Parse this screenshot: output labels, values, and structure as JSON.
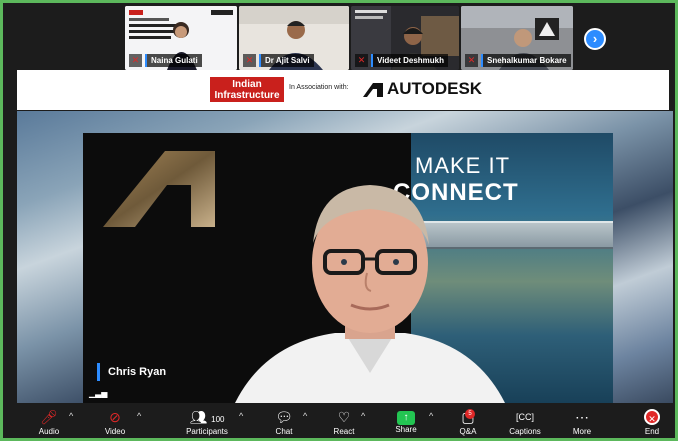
{
  "participants_strip": {
    "tiles": [
      {
        "name": "Naina Gulati"
      },
      {
        "name": "Dr Ajit Salvi"
      },
      {
        "name": "Videet Deshmukh"
      },
      {
        "name": "Snehalkumar Bokare"
      }
    ],
    "next_icon": "chevron-right-icon"
  },
  "banner": {
    "sponsor_logo_text": "Indian Infrastructure",
    "association_text": "In Association with:",
    "partner_logo_text": "AUTODESK"
  },
  "main_video": {
    "slide_line1": "MAKE IT",
    "slide_line2": "CONNECT",
    "speaker_name": "Chris Ryan"
  },
  "toolbar": {
    "items": [
      {
        "label": "Audio",
        "icon": "microphone-muted-icon"
      },
      {
        "label": "Video",
        "icon": "video-off-icon"
      },
      {
        "label": "Participants",
        "icon": "participants-icon",
        "count": "100"
      },
      {
        "label": "Chat",
        "icon": "chat-icon"
      },
      {
        "label": "React",
        "icon": "heart-icon"
      },
      {
        "label": "Share",
        "icon": "share-screen-icon"
      },
      {
        "label": "Q&A",
        "icon": "qa-icon",
        "badge": "5"
      },
      {
        "label": "Captions",
        "icon": "captions-icon"
      },
      {
        "label": "More",
        "icon": "more-icon"
      },
      {
        "label": "End",
        "icon": "end-call-icon"
      }
    ]
  },
  "colors": {
    "active_border": "#5cb85c",
    "accent": "#2d8cff",
    "end_red": "#e02828",
    "share_green": "#23c552"
  }
}
